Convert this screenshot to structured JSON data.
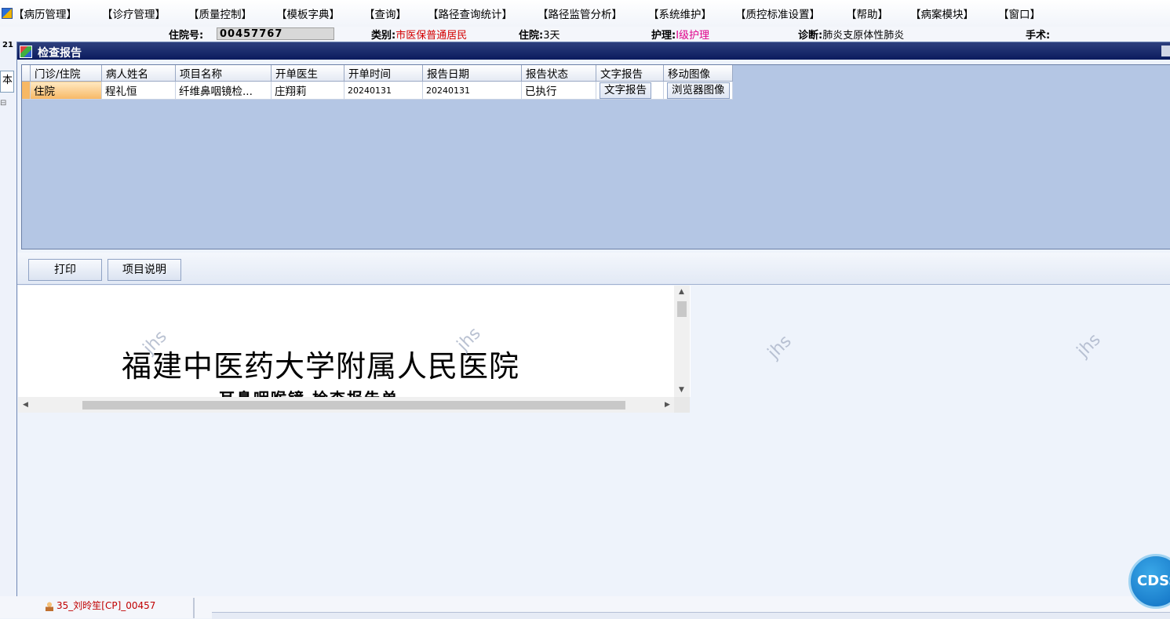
{
  "menu": [
    "【病历管理】",
    "【诊疗管理】",
    "【质量控制】",
    "【模板字典】",
    "【查询】",
    "【路径查询统计】",
    "【路径监管分析】",
    "【系统维护】",
    "【质控标准设置】",
    "【帮助】",
    "【病案模块】",
    "【窗口】"
  ],
  "patient_info": {
    "admission_label": "住院号:",
    "admission_value": "00457767",
    "category_label": "类别:",
    "category_value": "市医保普通居民",
    "stay_label": "住院:",
    "stay_value": "3天",
    "nursing_label": "护理:",
    "nursing_value": "Ⅰ级护理",
    "diagnosis_label": "诊断:",
    "diagnosis_value": "肺炎支原体性肺炎",
    "surgery_label": "手术:"
  },
  "left_panel": {
    "number": "21",
    "tab": "本",
    "tree_toggle": "⊟"
  },
  "dialog": {
    "title": "检查报告",
    "columns": [
      "门诊/住院",
      "病人姓名",
      "项目名称",
      "开单医生",
      "开单时间",
      "报告日期",
      "报告状态",
      "文字报告",
      "移动图像"
    ],
    "rows": [
      {
        "type": "住院",
        "name": "程礼恒",
        "item": "纤维鼻咽镜检...",
        "doctor": "庄翔莉",
        "order_time": "20240131",
        "report_date": "20240131",
        "status": "已执行",
        "text_report": "文字报告",
        "image": "浏览器图像"
      }
    ],
    "toolbar": {
      "print": "打印",
      "item_desc": "项目说明"
    },
    "document": {
      "hospital": "福建中医药大学附属人民医院",
      "subtitle": "耳鼻咽喉镜 检查报告单"
    }
  },
  "watermark": "jhs",
  "bottom": {
    "patient_entry": "35_刘昤笙[CP]_00457"
  },
  "cdss_label": "CDSS",
  "colors": {
    "title_bar": "#0b1b5e",
    "grid_bg": "#b4c6e4",
    "selected_cell": "#f7b865",
    "category_red": "#d40000",
    "nursing_pink": "#e0008a"
  },
  "icons": [
    "app-icon",
    "dialog-icon",
    "person-icon",
    "scroll-up-icon",
    "scroll-down-icon",
    "scroll-left-icon",
    "scroll-right-icon"
  ]
}
